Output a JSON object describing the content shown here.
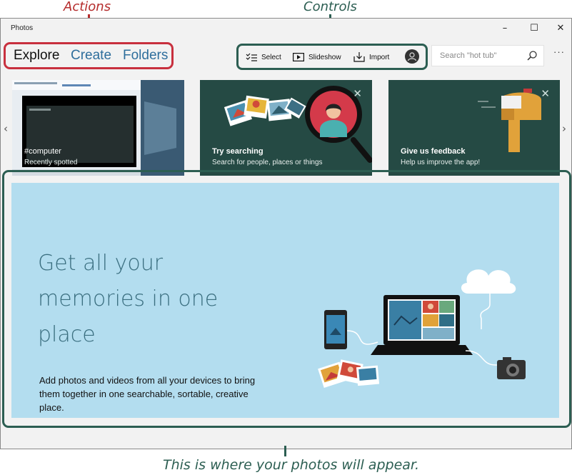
{
  "callouts": {
    "actions": "Actions",
    "controls": "Controls",
    "photos_area": "This is where your photos will appear."
  },
  "window": {
    "title": "Photos",
    "minimize": "–",
    "maximize": "☐",
    "close": "✕"
  },
  "nav": {
    "explore": "Explore",
    "create": "Create",
    "folders": "Folders"
  },
  "controls": {
    "select": "Select",
    "slideshow": "Slideshow",
    "import": "Import"
  },
  "search": {
    "placeholder": "Search \"hot tub\""
  },
  "more_label": "···",
  "cards": [
    {
      "title": "#computer",
      "subtitle": "Recently spotted"
    },
    {
      "title": "Try searching",
      "subtitle": "Search for people, places or things"
    },
    {
      "title": "Give us feedback",
      "subtitle": "Help us improve the app!"
    }
  ],
  "carousel": {
    "prev": "‹",
    "next": "›"
  },
  "hero": {
    "heading": "Get all your memories in one place",
    "body": "Add photos and videos from all your devices to bring them together in one searchable, sortable, creative place."
  },
  "colors": {
    "actions_accent": "#c8303e",
    "controls_accent": "#2c5e52",
    "link_blue": "#2e6e9c",
    "hero_background": "#b3ddef",
    "card_background": "#254a44"
  }
}
